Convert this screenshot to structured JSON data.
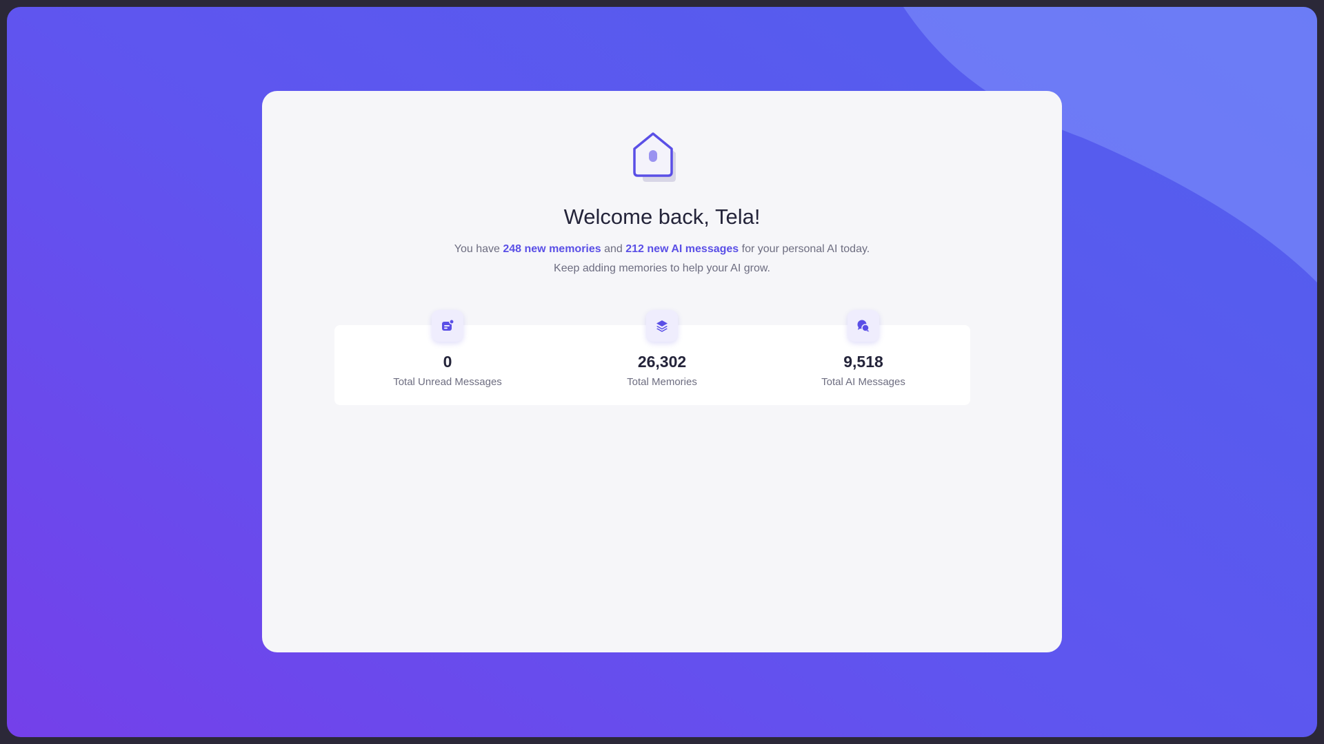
{
  "welcome": {
    "title": "Welcome back, Tela!",
    "line1_prefix": "You have ",
    "new_memories": "248 new memories",
    "line1_middle": " and ",
    "new_ai_messages": "212 new AI messages",
    "line1_suffix": " for your personal AI today.",
    "line2": "Keep adding memories to help your AI grow."
  },
  "stats": [
    {
      "icon": "message-badge-icon",
      "value": "0",
      "label": "Total Unread Messages"
    },
    {
      "icon": "layers-icon",
      "value": "26,302",
      "label": "Total Memories"
    },
    {
      "icon": "chat-bubbles-icon",
      "value": "9,518",
      "label": "Total AI Messages"
    }
  ],
  "colors": {
    "accent": "#5a4fe6",
    "background_start": "#7440ea",
    "background_end": "#5160ee",
    "card": "#f6f6f9"
  }
}
